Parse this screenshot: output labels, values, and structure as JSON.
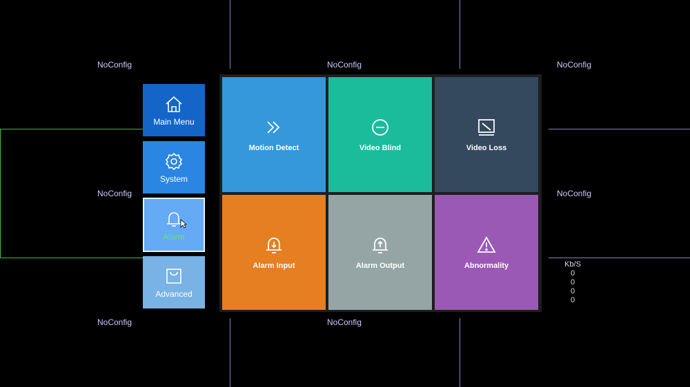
{
  "cameras": [
    "NoConfig",
    "NoConfig",
    "NoConfig",
    "NoConfig",
    "NoConfig",
    "NoConfig",
    "NoConfig"
  ],
  "sidebar": {
    "items": [
      {
        "label": "Main Menu",
        "icon": "home-icon",
        "color": "#1565c8"
      },
      {
        "label": "System",
        "icon": "gear-icon",
        "color": "#2a86e2"
      },
      {
        "label": "Alarm",
        "icon": "bell-icon",
        "color": "#64aaf4",
        "label_color": "#69e36b",
        "active": true
      },
      {
        "label": "Advanced",
        "icon": "bag-icon",
        "color": "#79b2e4"
      }
    ]
  },
  "tiles": [
    {
      "label": "Motion Detect",
      "icon": "chevrons-right-icon",
      "color": "#3498db"
    },
    {
      "label": "Video Blind",
      "icon": "minus-circle-icon",
      "color": "#1abc9c"
    },
    {
      "label": "Video Loss",
      "icon": "monitor-slash-icon",
      "color": "#34495e"
    },
    {
      "label": "Alarm Input",
      "icon": "bell-down-icon",
      "color": "#e67e22"
    },
    {
      "label": "Alarm Output",
      "icon": "bell-up-icon",
      "color": "#95a5a6"
    },
    {
      "label": "Abnormality",
      "icon": "warning-icon",
      "color": "#9b59b6"
    }
  ],
  "bitrate": {
    "header": "Kb/S",
    "values": [
      "0",
      "0",
      "0",
      "0"
    ]
  }
}
